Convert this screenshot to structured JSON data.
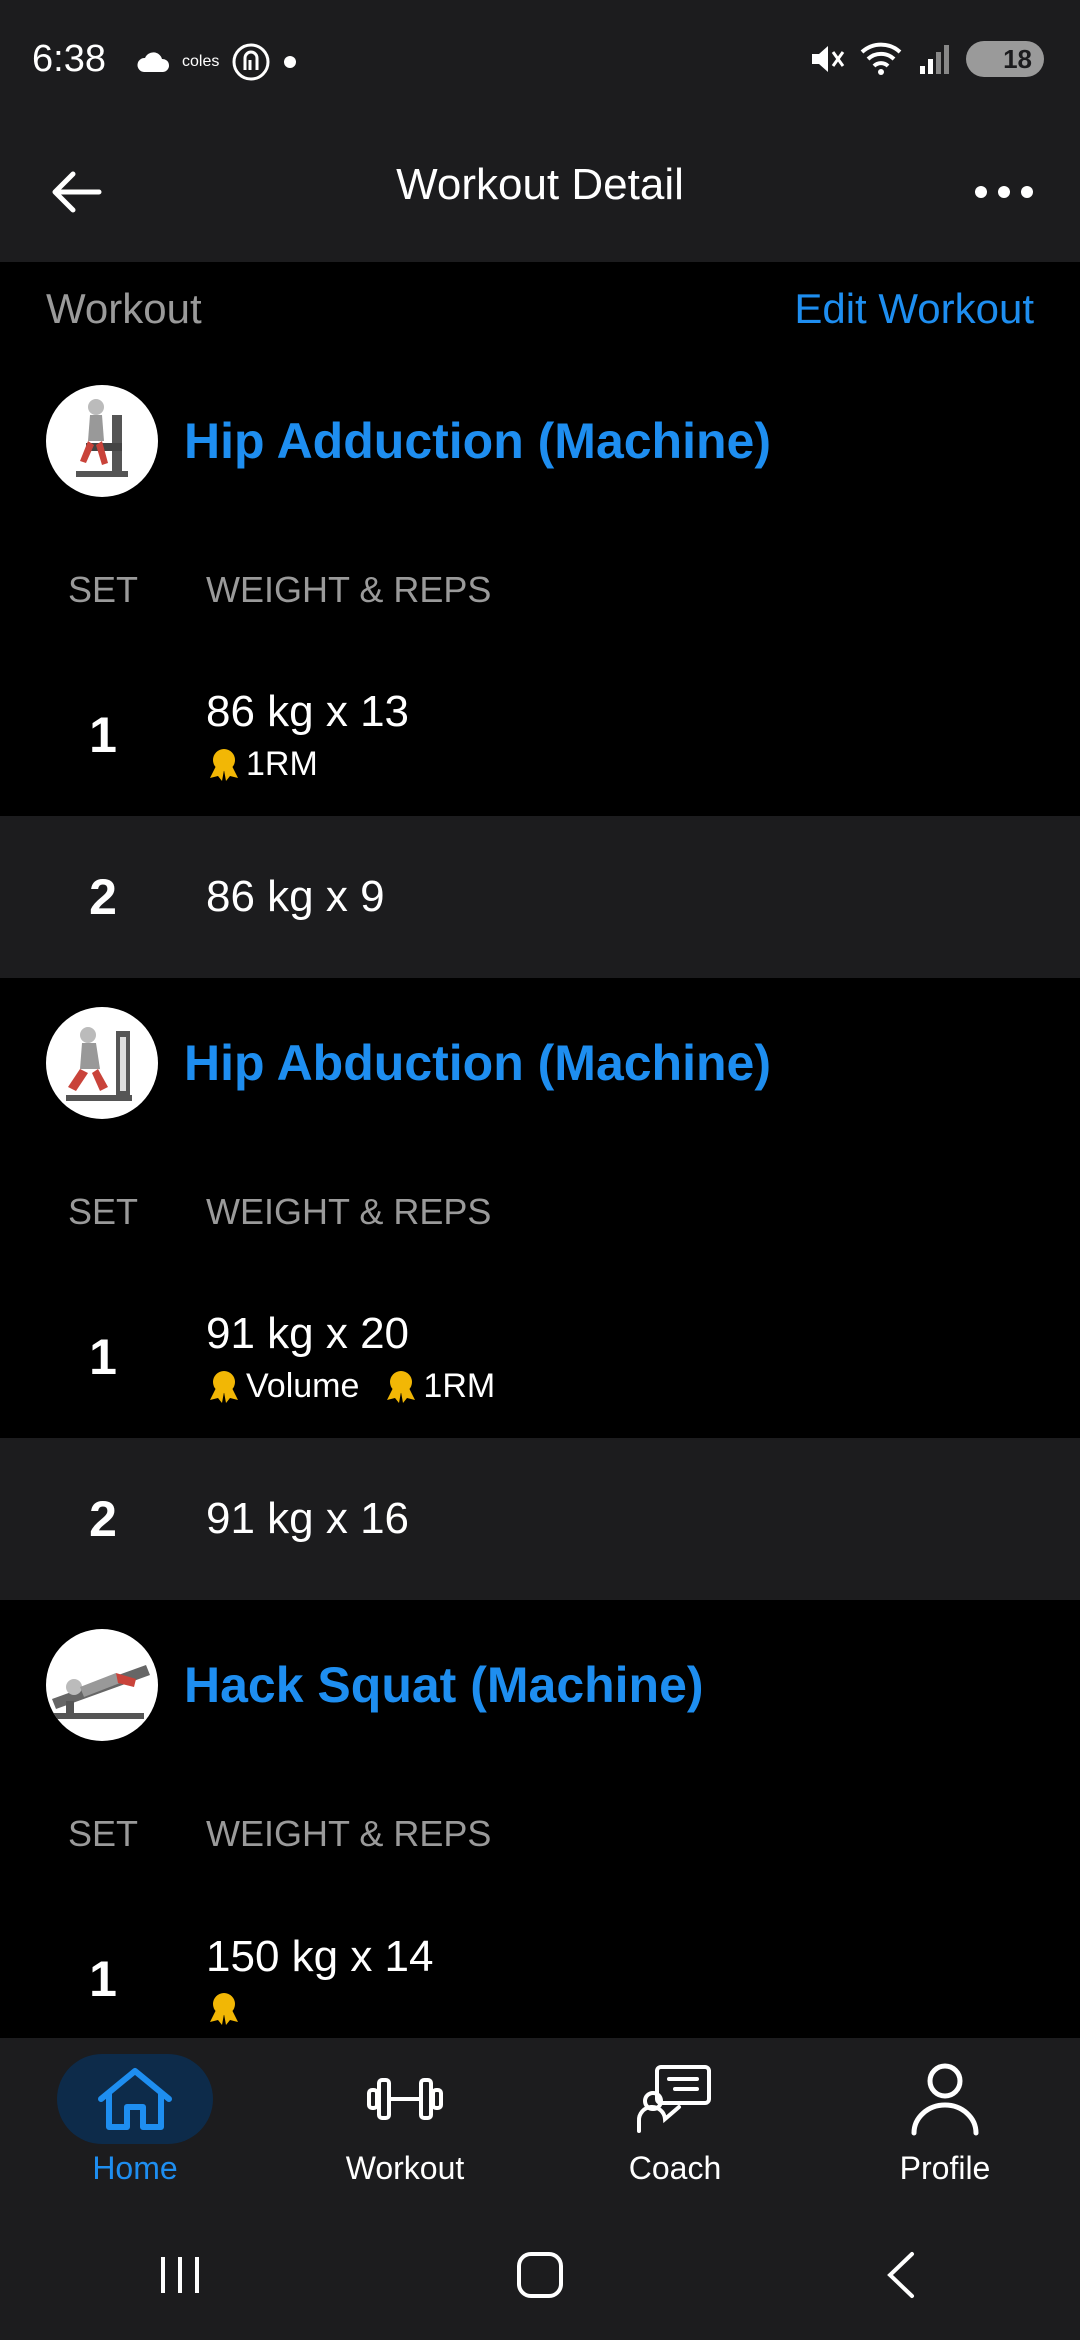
{
  "status_bar": {
    "time": "6:38",
    "carrier_text": "coles",
    "battery": "18"
  },
  "header": {
    "title": "Workout Detail"
  },
  "section": {
    "label": "Workout",
    "edit_label": "Edit Workout"
  },
  "columns": {
    "set": "SET",
    "weight_reps": "WEIGHT & REPS"
  },
  "exercises": [
    {
      "name": "Hip Adduction (Machine)",
      "sets": [
        {
          "num": "1",
          "value": "86 kg x 13",
          "badges": [
            "1RM"
          ]
        },
        {
          "num": "2",
          "value": "86 kg x 9",
          "badges": []
        }
      ]
    },
    {
      "name": "Hip Abduction (Machine)",
      "sets": [
        {
          "num": "1",
          "value": "91 kg x 20",
          "badges": [
            "Volume",
            "1RM"
          ]
        },
        {
          "num": "2",
          "value": "91 kg x 16",
          "badges": []
        }
      ]
    },
    {
      "name": "Hack Squat (Machine)",
      "sets": [
        {
          "num": "1",
          "value": "150 kg x 14",
          "badges": []
        }
      ]
    }
  ],
  "bottom_nav": {
    "items": [
      {
        "label": "Home",
        "icon": "home-icon",
        "active": true
      },
      {
        "label": "Workout",
        "icon": "dumbbell-icon",
        "active": false
      },
      {
        "label": "Coach",
        "icon": "coach-icon",
        "active": false
      },
      {
        "label": "Profile",
        "icon": "profile-icon",
        "active": false
      }
    ]
  },
  "colors": {
    "accent": "#1e8ef0",
    "background": "#000000",
    "surface": "#1c1c1e",
    "muted_text": "#9a9a9a",
    "medal": "#f2b705"
  }
}
